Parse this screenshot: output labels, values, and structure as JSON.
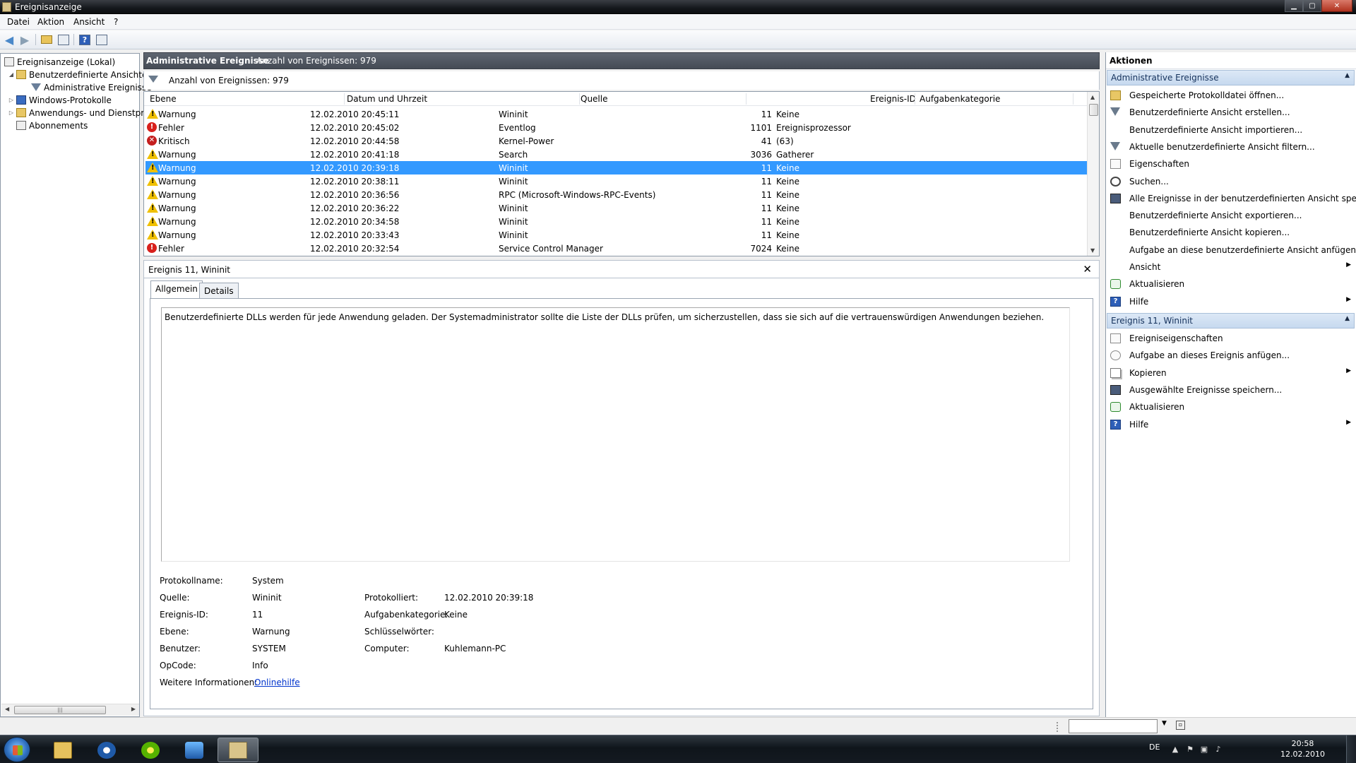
{
  "window": {
    "title": "Ereignisanzeige"
  },
  "menu": [
    "Datei",
    "Aktion",
    "Ansicht",
    "?"
  ],
  "tree": {
    "root": "Ereignisanzeige (Lokal)",
    "custom_views": "Benutzerdefinierte Ansichten",
    "admin_events": "Administrative Ereignisse",
    "windows_logs": "Windows-Protokolle",
    "app_service_logs": "Anwendungs- und Dienstprotokolle",
    "subscriptions": "Abonnements"
  },
  "header": {
    "title": "Administrative Ereignisse",
    "count": "Anzahl von Ereignissen: 979"
  },
  "filter": {
    "text": "Anzahl von Ereignissen: 979"
  },
  "columns": {
    "level": "Ebene",
    "datetime": "Datum und Uhrzeit",
    "source": "Quelle",
    "event_id": "Ereignis-ID",
    "task_category": "Aufgabenkategorie"
  },
  "events": [
    {
      "level": "Warnung",
      "icon": "warning-icon",
      "datetime": "12.02.2010 20:45:11",
      "source": "Wininit",
      "id": "11",
      "category": "Keine"
    },
    {
      "level": "Fehler",
      "icon": "error-icon",
      "datetime": "12.02.2010 20:45:02",
      "source": "Eventlog",
      "id": "1101",
      "category": "Ereignisprozessor"
    },
    {
      "level": "Kritisch",
      "icon": "critical-icon",
      "datetime": "12.02.2010 20:44:58",
      "source": "Kernel-Power",
      "id": "41",
      "category": "(63)"
    },
    {
      "level": "Warnung",
      "icon": "warning-icon",
      "datetime": "12.02.2010 20:41:18",
      "source": "Search",
      "id": "3036",
      "category": "Gatherer"
    },
    {
      "level": "Warnung",
      "icon": "warning-icon",
      "datetime": "12.02.2010 20:39:18",
      "source": "Wininit",
      "id": "11",
      "category": "Keine"
    },
    {
      "level": "Warnung",
      "icon": "warning-icon",
      "datetime": "12.02.2010 20:38:11",
      "source": "Wininit",
      "id": "11",
      "category": "Keine"
    },
    {
      "level": "Warnung",
      "icon": "warning-icon",
      "datetime": "12.02.2010 20:36:56",
      "source": "RPC (Microsoft-Windows-RPC-Events)",
      "id": "11",
      "category": "Keine"
    },
    {
      "level": "Warnung",
      "icon": "warning-icon",
      "datetime": "12.02.2010 20:36:22",
      "source": "Wininit",
      "id": "11",
      "category": "Keine"
    },
    {
      "level": "Warnung",
      "icon": "warning-icon",
      "datetime": "12.02.2010 20:34:58",
      "source": "Wininit",
      "id": "11",
      "category": "Keine"
    },
    {
      "level": "Warnung",
      "icon": "warning-icon",
      "datetime": "12.02.2010 20:33:43",
      "source": "Wininit",
      "id": "11",
      "category": "Keine"
    },
    {
      "level": "Fehler",
      "icon": "error-icon",
      "datetime": "12.02.2010 20:32:54",
      "source": "Service Control Manager",
      "id": "7024",
      "category": "Keine"
    }
  ],
  "selected_event_index": 4,
  "detail": {
    "title": "Ereignis 11, Wininit",
    "tab_general": "Allgemein",
    "tab_details": "Details",
    "description": "Benutzerdefinierte DLLs werden für jede Anwendung geladen. Der Systemadministrator sollte die Liste der DLLs prüfen, um sicherzustellen, dass sie sich auf die vertrauenswürdigen Anwendungen beziehen.",
    "labels": {
      "log_name": "Protokollname:",
      "source": "Quelle:",
      "event_id": "Ereignis-ID:",
      "level": "Ebene:",
      "user": "Benutzer:",
      "opcode": "OpCode:",
      "more_info": "Weitere Informationen:",
      "logged": "Protokolliert:",
      "task_category": "Aufgabenkategorie:",
      "keywords": "Schlüsselwörter:",
      "computer": "Computer:"
    },
    "values": {
      "log_name": "System",
      "source": "Wininit",
      "event_id": "11",
      "level": "Warnung",
      "user": "SYSTEM",
      "opcode": "Info",
      "more_info": "Onlinehilfe",
      "logged": "12.02.2010 20:39:18",
      "task_category": "Keine",
      "keywords": "",
      "computer": "Kuhlemann-PC"
    }
  },
  "actions": {
    "title": "Aktionen",
    "section1": "Administrative Ereignisse",
    "items1": [
      {
        "label": "Gespeicherte Protokolldatei öffnen...",
        "icon": "open-log-icon"
      },
      {
        "label": "Benutzerdefinierte Ansicht erstellen...",
        "icon": "create-view-icon"
      },
      {
        "label": "Benutzerdefinierte Ansicht importieren...",
        "icon": ""
      },
      {
        "label": "Aktuelle benutzerdefinierte Ansicht filtern...",
        "icon": "filter-icon"
      },
      {
        "label": "Eigenschaften",
        "icon": "properties-icon"
      },
      {
        "label": "Suchen...",
        "icon": "search-icon"
      },
      {
        "label": "Alle Ereignisse in der benutzerdefinierten Ansicht speic...",
        "icon": "save-icon"
      },
      {
        "label": "Benutzerdefinierte Ansicht exportieren...",
        "icon": ""
      },
      {
        "label": "Benutzerdefinierte Ansicht kopieren...",
        "icon": ""
      },
      {
        "label": "Aufgabe an diese benutzerdefinierte Ansicht anfügen...",
        "icon": ""
      },
      {
        "label": "Ansicht",
        "icon": ""
      },
      {
        "label": "Aktualisieren",
        "icon": "refresh-icon"
      },
      {
        "label": "Hilfe",
        "icon": "help-icon"
      }
    ],
    "section2": "Ereignis 11, Wininit",
    "items2": [
      {
        "label": "Ereigniseigenschaften",
        "icon": "properties-icon"
      },
      {
        "label": "Aufgabe an dieses Ereignis anfügen...",
        "icon": "task-icon"
      },
      {
        "label": "Kopieren",
        "icon": "copy-icon"
      },
      {
        "label": "Ausgewählte Ereignisse speichern...",
        "icon": "save-icon"
      },
      {
        "label": "Aktualisieren",
        "icon": "refresh-icon"
      },
      {
        "label": "Hilfe",
        "icon": "help-icon"
      }
    ]
  },
  "taskbar": {
    "lang": "DE",
    "time": "20:58",
    "date": "12.02.2010"
  }
}
